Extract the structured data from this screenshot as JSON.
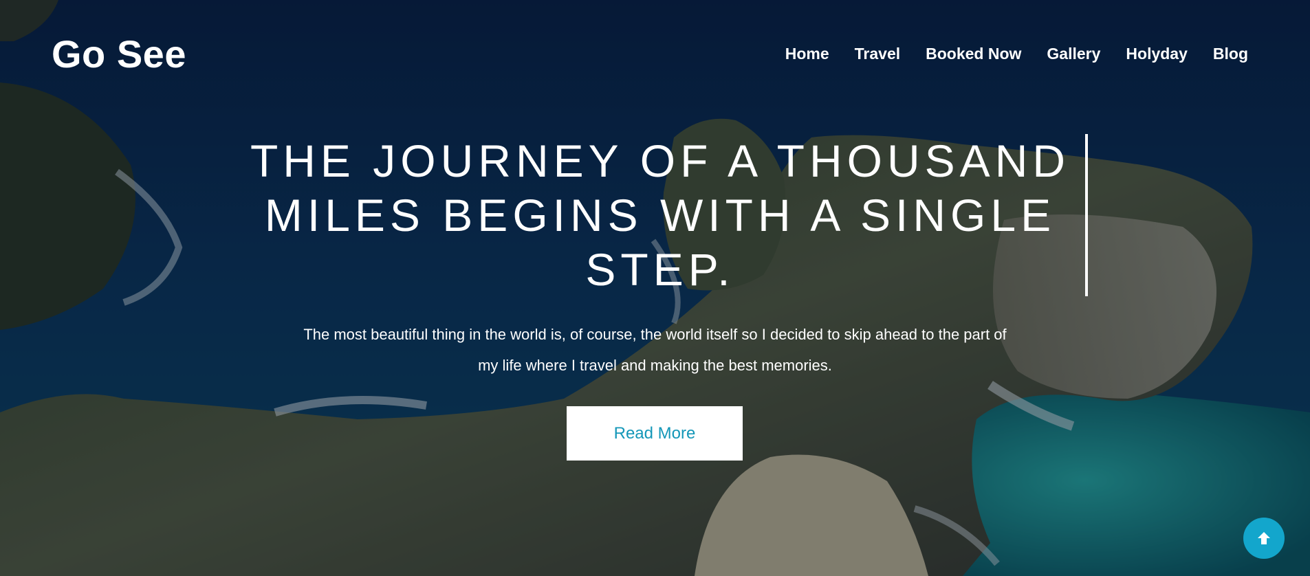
{
  "brand": {
    "logo_text": "Go See"
  },
  "nav": {
    "items": [
      {
        "label": "Home"
      },
      {
        "label": "Travel"
      },
      {
        "label": "Booked Now"
      },
      {
        "label": "Gallery"
      },
      {
        "label": "Holyday"
      },
      {
        "label": "Blog"
      }
    ]
  },
  "hero": {
    "headline": "THE JOURNEY OF A THOUSAND MILES BEGINS WITH A SINGLE STEP.",
    "subtitle": "The most beautiful thing in the world is, of course, the world itself so I decided to skip ahead to the part of my life where I travel and making the best memories.",
    "cta_label": "Read More"
  },
  "scroll_top": {
    "icon": "arrow-up-circle-icon"
  },
  "colors": {
    "accent": "#13a6cc",
    "cta_text": "#1497b8",
    "text": "#ffffff"
  }
}
